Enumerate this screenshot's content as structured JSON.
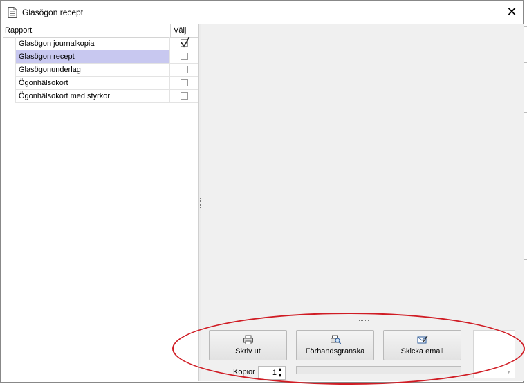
{
  "window": {
    "title": "Glasögon recept",
    "close_glyph": "✕"
  },
  "list": {
    "columns": [
      "Rapport",
      "Välj"
    ],
    "rows": [
      {
        "label": "Glasögon journalkopia",
        "checked": true,
        "selected": false
      },
      {
        "label": "Glasögon recept",
        "checked": false,
        "selected": true
      },
      {
        "label": "Glasögonunderlag",
        "checked": false,
        "selected": false
      },
      {
        "label": "Ögonhälsokort",
        "checked": false,
        "selected": false
      },
      {
        "label": "Ögonhälsokort med styrkor",
        "checked": false,
        "selected": false
      }
    ]
  },
  "actions": {
    "print_label": "Skriv ut",
    "preview_label": "Förhandsgranska",
    "email_label": "Skicka email",
    "print_icon": "printer-icon",
    "preview_icon": "magnifier-print-preview-icon",
    "email_icon": "email-pencil-icon"
  },
  "copies": {
    "label": "Kopior",
    "value": "1"
  },
  "colors": {
    "selection": "#c8c8f0",
    "annotation_ellipse": "#d01c24",
    "panel_background": "#f0f0f0"
  }
}
